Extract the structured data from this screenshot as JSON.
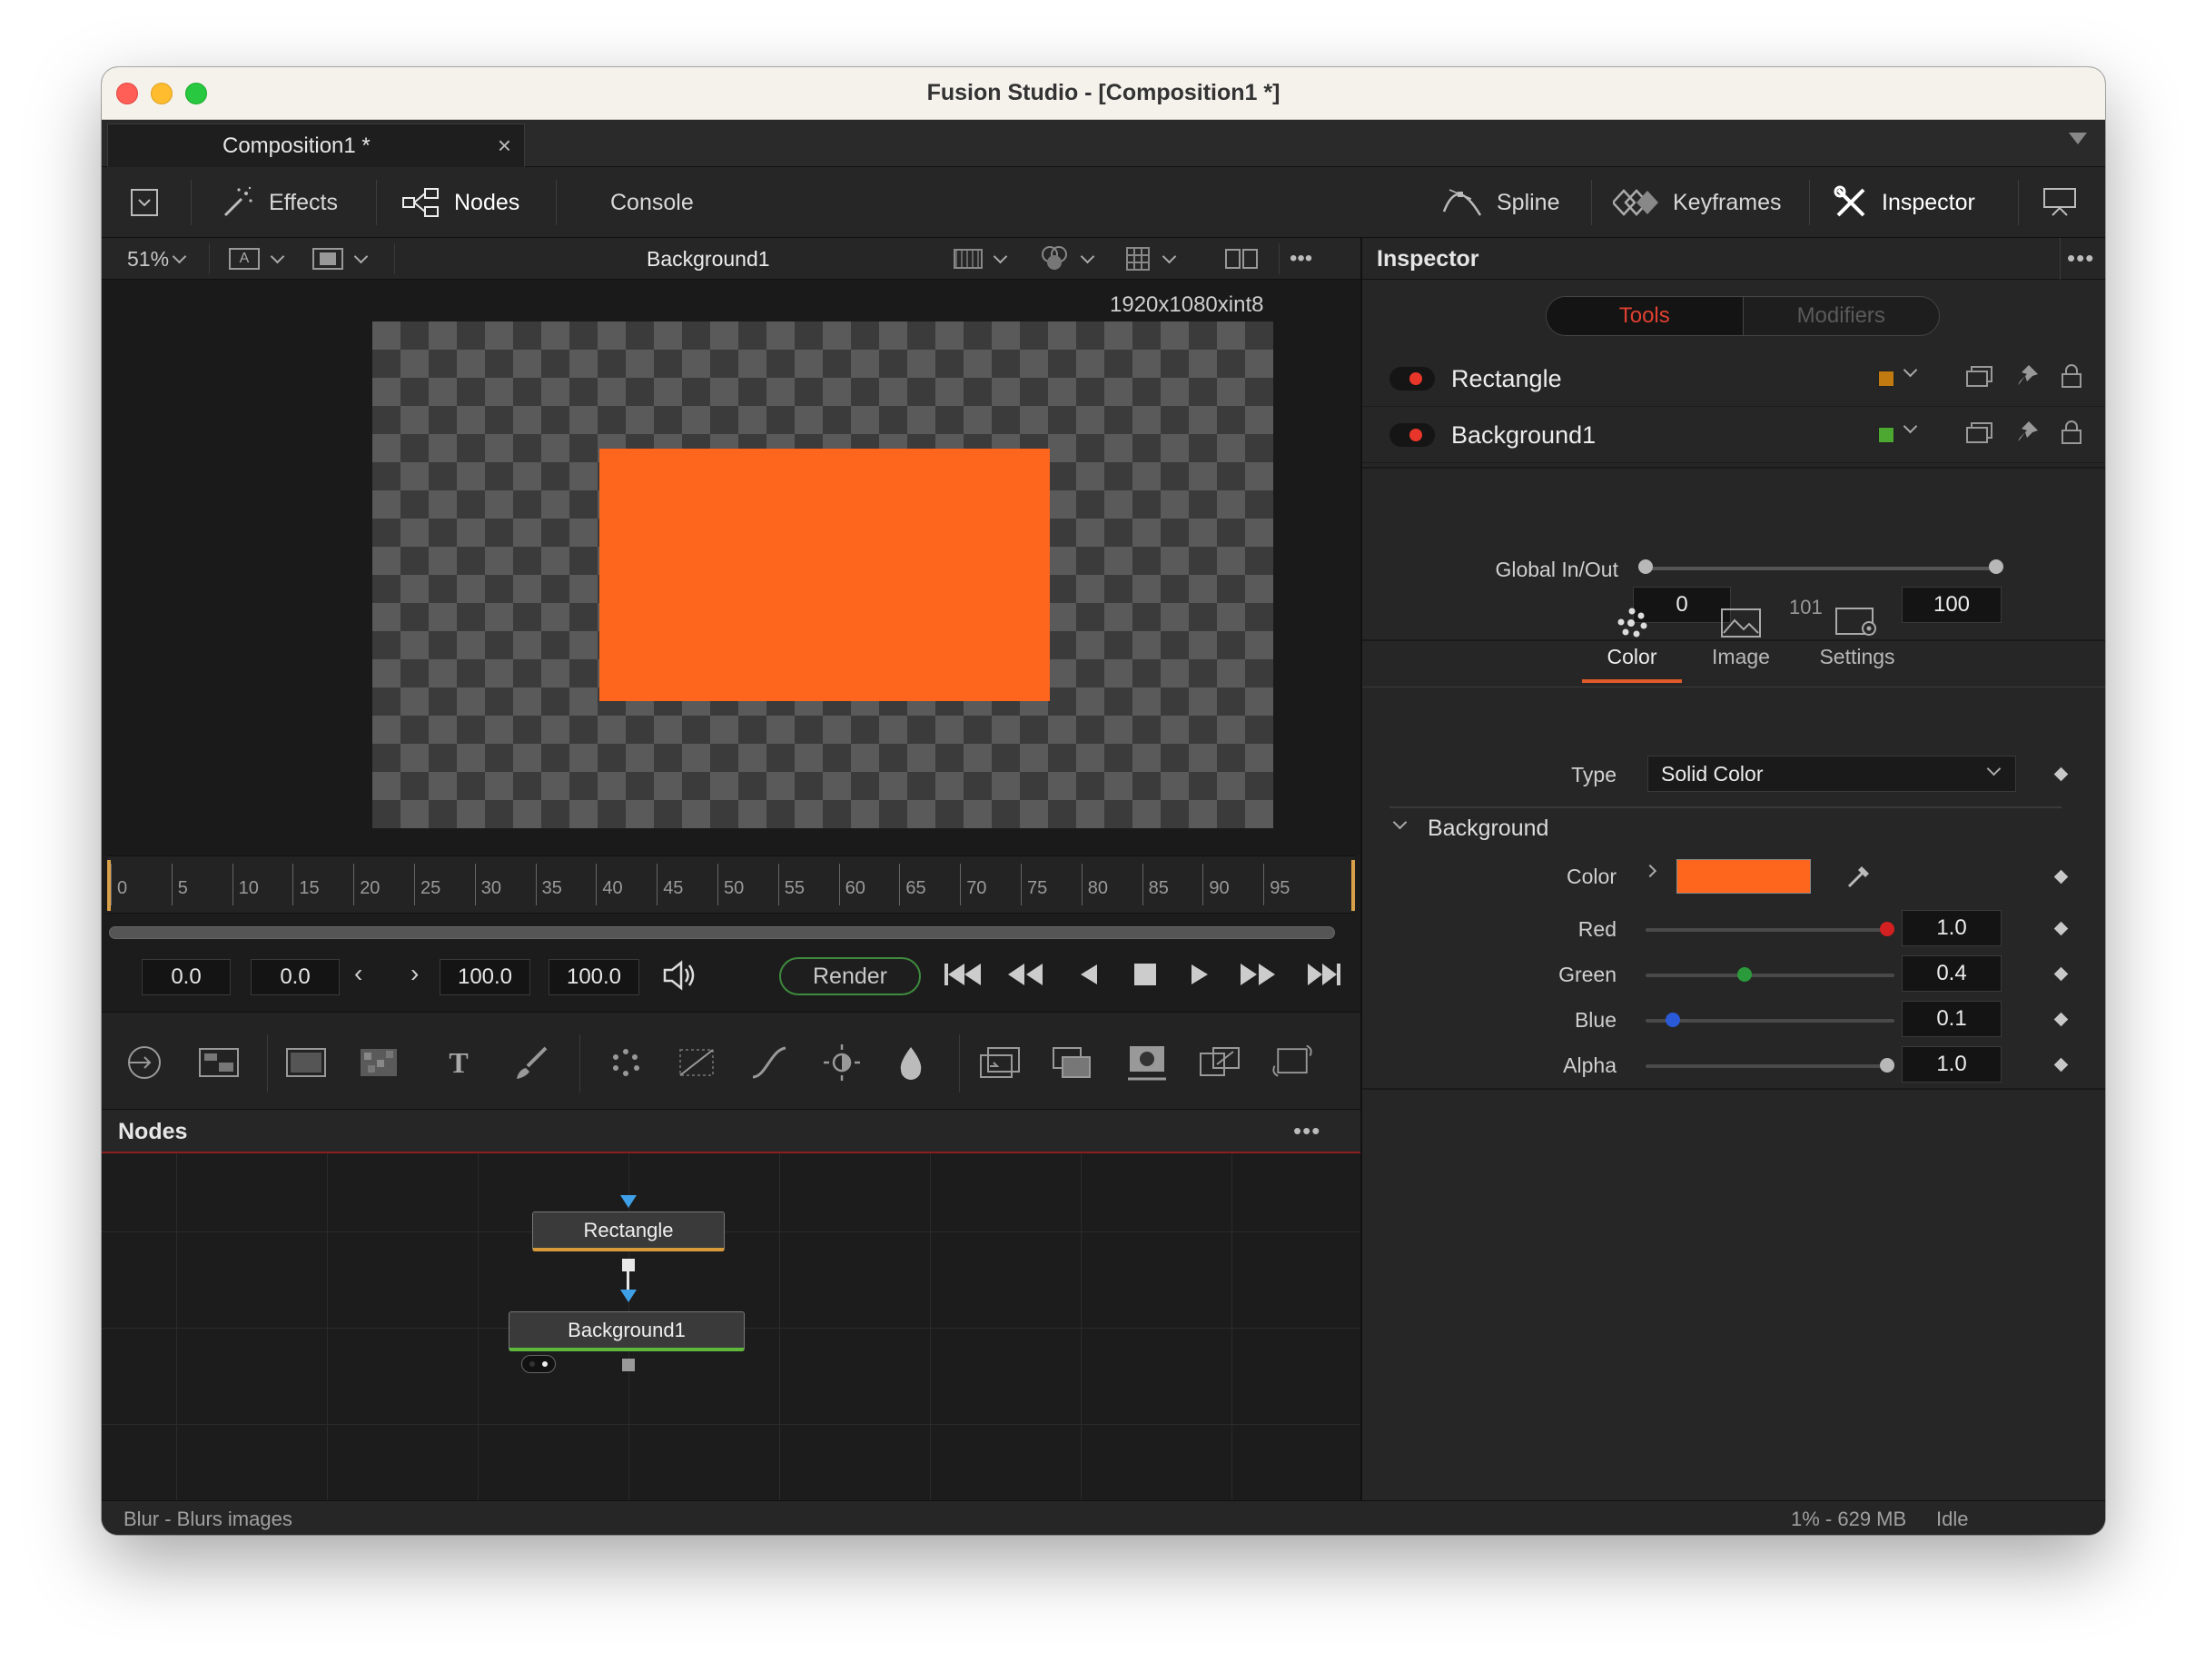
{
  "window": {
    "title": "Fusion Studio - [Composition1 *]"
  },
  "tab": {
    "label": "Composition1 *",
    "close": "×"
  },
  "toolbar": {
    "effects": "Effects",
    "nodes": "Nodes",
    "console": "Console",
    "spline": "Spline",
    "keyframes": "Keyframes",
    "inspector": "Inspector"
  },
  "viewer": {
    "zoom": "51%",
    "name": "Background1",
    "resolution": "1920x1080xint8",
    "more": "•••",
    "a_label": "A"
  },
  "timeline": {
    "ticks": [
      "0",
      "5",
      "10",
      "15",
      "20",
      "25",
      "30",
      "35",
      "40",
      "45",
      "50",
      "55",
      "60",
      "65",
      "70",
      "75",
      "80",
      "85",
      "90",
      "95"
    ]
  },
  "transport": {
    "global_start": "0.0",
    "render_start": "0.0",
    "render_end": "100.0",
    "global_end": "100.0",
    "render": "Render"
  },
  "nodes": {
    "title": "Nodes",
    "more": "•••",
    "rectangle": "Rectangle",
    "background": "Background1"
  },
  "status": {
    "hint": "Blur - Blurs images",
    "usage": "1% -  629 MB",
    "state": "Idle"
  },
  "inspector": {
    "title": "Inspector",
    "more": "•••",
    "seg_tools": "Tools",
    "seg_modifiers": "Modifiers",
    "tools": [
      {
        "name": "Rectangle",
        "swatch": "#c07a10"
      },
      {
        "name": "Background1",
        "swatch": "#4ca830"
      }
    ],
    "global_label": "Global In/Out",
    "global_in": "0",
    "global_mid": "101",
    "global_out": "100",
    "tabs": {
      "color": "Color",
      "image": "Image",
      "settings": "Settings"
    },
    "type_label": "Type",
    "type_value": "Solid Color",
    "section": "Background",
    "color_label": "Color",
    "color_value": "#fe661d",
    "channels": [
      {
        "label": "Red",
        "value": "1.0",
        "level": 1.0,
        "knob": "#d42020"
      },
      {
        "label": "Green",
        "value": "0.4",
        "level": 0.4,
        "knob": "#2a9a3a"
      },
      {
        "label": "Blue",
        "value": "0.1",
        "level": 0.1,
        "knob": "#2a5ad8"
      },
      {
        "label": "Alpha",
        "value": "1.0",
        "level": 1.0,
        "knob": "#b8b8b8"
      }
    ]
  }
}
